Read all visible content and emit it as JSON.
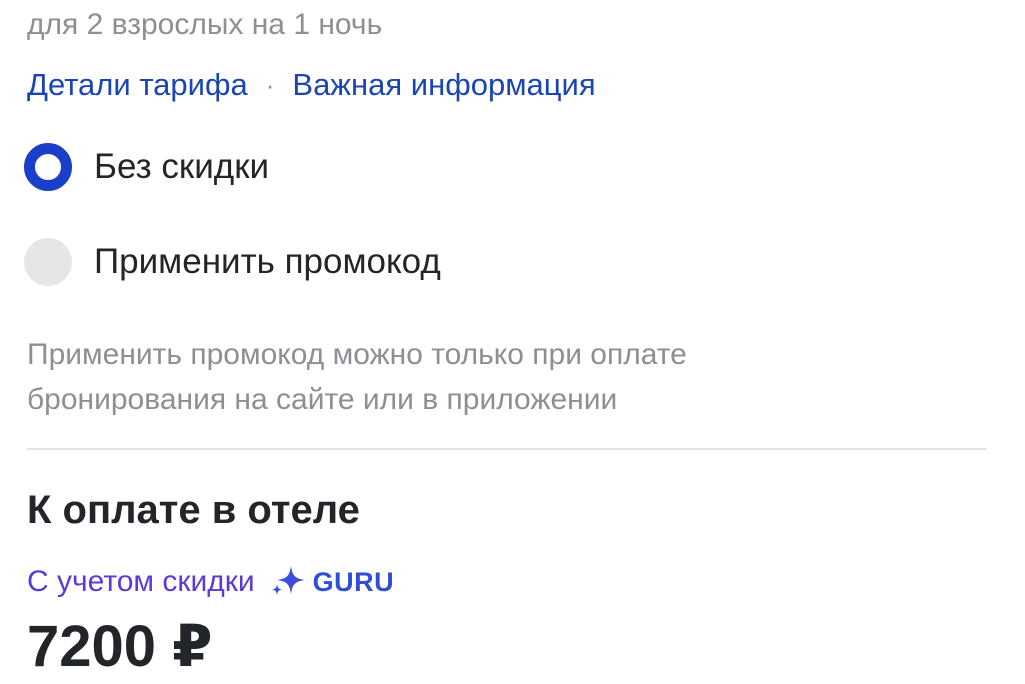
{
  "rate": {
    "guests_nights": "для 2 взрослых на 1 ночь",
    "links": {
      "tariff_details": "Детали тарифа",
      "separator": "·",
      "important_info": "Важная информация"
    }
  },
  "discount_options": {
    "selected": "Без скидки",
    "options": [
      {
        "label": "Без скидки",
        "checked": true
      },
      {
        "label": "Применить промокод",
        "checked": false
      }
    ],
    "note_line1": "Применить промокод можно только при оплате",
    "note_line2": "бронирования на сайте или в приложении"
  },
  "payment": {
    "title": "К оплате в отеле",
    "discount_label": "С учетом скидки",
    "badge_icon": "sparkle-icon",
    "badge_text": "GURU",
    "price": "7200 ₽"
  },
  "colors": {
    "link": "#1b45b4",
    "radio_checked": "#1b3fc9",
    "discount_text": "#5b3ad6",
    "muted_text": "#8c8f93",
    "main_text": "#222529"
  }
}
